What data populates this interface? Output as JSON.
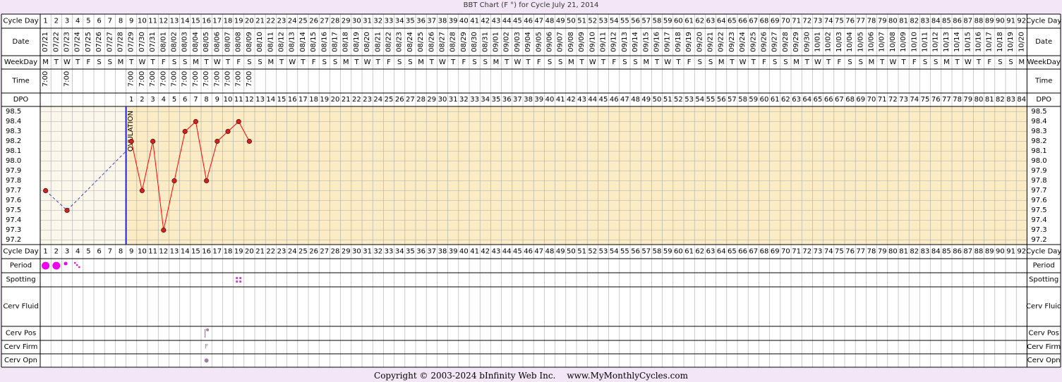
{
  "title": "BBT Chart (F °) for Cycle July 21, 2014",
  "row_labels": {
    "cycle_day": "Cycle Day",
    "date": "Date",
    "weekday": "WeekDay",
    "time": "Time",
    "dpo": "DPO",
    "period": "Period",
    "spotting": "Spotting",
    "cerv_fluid": "Cerv Fluid",
    "cerv_pos": "Cerv Pos",
    "cerv_firm": "Cerv Firm",
    "cerv_opn": "Cerv Opn"
  },
  "ovulation_label": "OVULATION",
  "copyright": "Copyright © 2003-2024 bInfinity Web Inc.",
  "website": "www.MyMonthlyCycles.com",
  "colors": {
    "background": "#f3e6f7",
    "pre_ovulation_fill": "#fbf7ea",
    "post_ovulation_fill": "#fbecc5",
    "grid": "#aaaaaa",
    "temp_line": "#ff0000",
    "temp_point": "#cc2222",
    "coverline_dash": "#4444cc",
    "ovulation_line": "#2222cc",
    "period_dot": "#ee00ee",
    "spotting_dot": "#cc44cc",
    "cervix_mark": "#a080a0"
  },
  "chart_data": {
    "type": "line",
    "start_date": "2014-07-21",
    "cycle_days": 92,
    "days": [
      "07/21",
      "07/22",
      "07/23",
      "07/24",
      "07/25",
      "07/26",
      "07/27",
      "07/28",
      "07/29",
      "07/30",
      "07/31",
      "08/01",
      "08/02",
      "08/03",
      "08/04",
      "08/05",
      "08/06",
      "08/07",
      "08/08",
      "08/09",
      "08/10",
      "08/11",
      "08/12",
      "08/13",
      "08/14",
      "08/15",
      "08/16",
      "08/17",
      "08/18",
      "08/19",
      "08/20",
      "08/21",
      "08/22",
      "08/23",
      "08/24",
      "08/25",
      "08/26",
      "08/27",
      "08/28",
      "08/29",
      "08/30",
      "08/31",
      "09/01",
      "09/02",
      "09/03",
      "09/04",
      "09/05",
      "09/06",
      "09/07",
      "09/08",
      "09/09",
      "09/10",
      "09/11",
      "09/12",
      "09/13",
      "09/14",
      "09/15",
      "09/16",
      "09/17",
      "09/18",
      "09/19",
      "09/20",
      "09/21",
      "09/22",
      "09/23",
      "09/24",
      "09/25",
      "09/26",
      "09/27",
      "09/28",
      "09/29",
      "09/30",
      "10/01",
      "10/02",
      "10/03",
      "10/04",
      "10/05",
      "10/06",
      "10/07",
      "10/08",
      "10/09",
      "10/10",
      "10/11",
      "10/12",
      "10/13",
      "10/14",
      "10/15",
      "10/16",
      "10/17",
      "10/18",
      "10/19",
      "10/20"
    ],
    "weekdays": [
      "M",
      "T",
      "W",
      "T",
      "F",
      "S",
      "S"
    ],
    "times": {
      "1": "7:00",
      "3": "7:00",
      "9": "7:00",
      "10": "7:00",
      "11": "7:00",
      "12": "7:00",
      "13": "7:00",
      "14": "7:00",
      "15": "7:00",
      "16": "7:00",
      "17": "7:00",
      "18": "7:00",
      "19": "7:00",
      "20": "7:00"
    },
    "dpo_start_day": 9,
    "dpo_count": 84,
    "ovulation_after_day": 8,
    "y_ticks": [
      "98.5",
      "98.4",
      "98.3",
      "98.2",
      "98.1",
      "98.0",
      "97.9",
      "97.8",
      "97.7",
      "97.6",
      "97.5",
      "97.4",
      "97.3",
      "97.2"
    ],
    "ylim": [
      97.2,
      98.5
    ],
    "temps_pre": [
      [
        1,
        97.7
      ],
      [
        3,
        97.5
      ]
    ],
    "coverline_to": [
      8,
      98.1
    ],
    "temps_post": [
      [
        9,
        98.2
      ],
      [
        10,
        97.7
      ],
      [
        11,
        98.2
      ],
      [
        12,
        97.3
      ],
      [
        13,
        97.8
      ],
      [
        14,
        98.3
      ],
      [
        15,
        98.4
      ],
      [
        16,
        97.8
      ],
      [
        17,
        98.2
      ],
      [
        18,
        98.3
      ],
      [
        19,
        98.4
      ],
      [
        20,
        98.2
      ]
    ],
    "period": [
      {
        "day": 1,
        "level": "heavy"
      },
      {
        "day": 2,
        "level": "heavy"
      },
      {
        "day": 3,
        "level": "light"
      },
      {
        "day": 4,
        "level": "spotting"
      }
    ],
    "spotting_days": [
      19
    ],
    "cerv_pos": {
      "day": 16,
      "value": "low"
    },
    "cerv_firm": {
      "day": 16,
      "value": "F"
    },
    "cerv_opn": {
      "day": 16,
      "value": "closed"
    }
  }
}
